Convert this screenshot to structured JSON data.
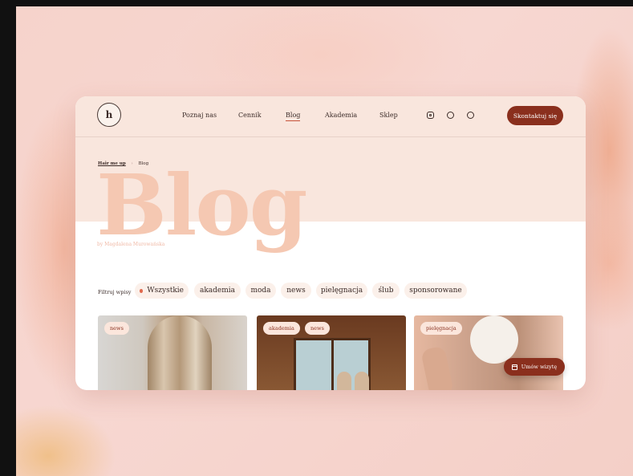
{
  "logo": {
    "text": "h"
  },
  "nav": {
    "items": [
      {
        "label": "Poznaj nas",
        "active": false
      },
      {
        "label": "Cennik",
        "active": false
      },
      {
        "label": "Blog",
        "active": true
      },
      {
        "label": "Akademia",
        "active": false
      },
      {
        "label": "Sklep",
        "active": false
      }
    ],
    "social": [
      "instagram-icon",
      "facebook-icon",
      "pinterest-icon"
    ],
    "contact_label": "Skontaktuj się"
  },
  "breadcrumb": {
    "home": "Hair me up",
    "separator": "›",
    "current": "Blog"
  },
  "hero": {
    "title": "Blog",
    "byline": "by Magdalena Murowańska"
  },
  "filters": {
    "label": "Filtruj wpisy",
    "chips": [
      "Wszystkie",
      "akademia",
      "moda",
      "news",
      "pielęgnacja",
      "ślub",
      "sponsorowane"
    ],
    "active": "Wszystkie"
  },
  "posts": [
    {
      "tags": [
        "news"
      ]
    },
    {
      "tags": [
        "akademia",
        "news"
      ]
    },
    {
      "tags": [
        "pielęgnacja"
      ]
    }
  ],
  "appointment": {
    "label": "Umów wizytę",
    "icon": "calendar-icon"
  },
  "colors": {
    "accent": "#8a2f1d",
    "hero_bg": "#f9e6dd",
    "title": "#f5c8b2",
    "dot": "#e0694e"
  }
}
